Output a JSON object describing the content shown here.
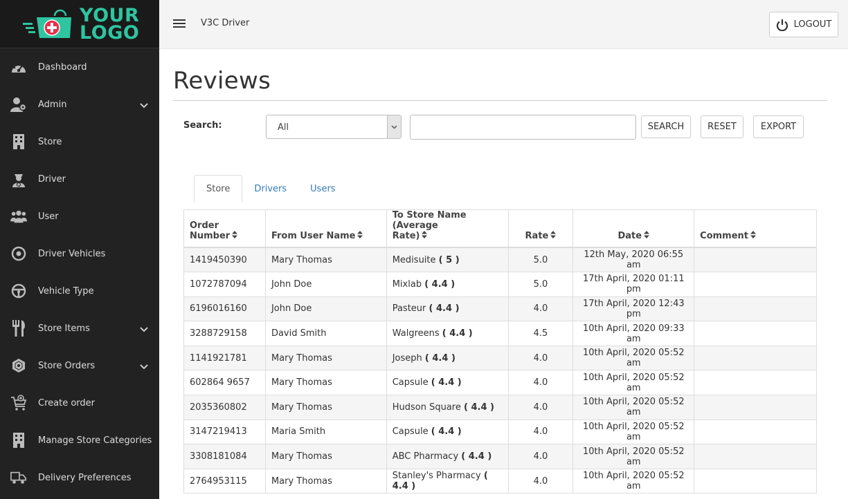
{
  "logo": {
    "line1": "YOUR",
    "line2": "LOGO"
  },
  "sidebar": {
    "items": [
      {
        "label": "Dashboard",
        "icon": "dashboard-icon"
      },
      {
        "label": "Admin",
        "icon": "admin-icon",
        "expandable": true
      },
      {
        "label": "Store",
        "icon": "building-icon"
      },
      {
        "label": "Driver",
        "icon": "driver-icon"
      },
      {
        "label": "User",
        "icon": "users-icon"
      },
      {
        "label": "Driver Vehicles",
        "icon": "target-icon"
      },
      {
        "label": "Vehicle Type",
        "icon": "steering-wheel-icon"
      },
      {
        "label": "Store Items",
        "icon": "utensils-icon",
        "expandable": true
      },
      {
        "label": "Store Orders",
        "icon": "orders-icon",
        "expandable": true
      },
      {
        "label": "Create order",
        "icon": "cart-plus-icon"
      },
      {
        "label": "Manage Store Categories",
        "icon": "building-icon"
      },
      {
        "label": "Delivery Preferences",
        "icon": "truck-icon"
      }
    ]
  },
  "header": {
    "app_title": "V3C Driver",
    "logout_label": "LOGOUT"
  },
  "page": {
    "title": "Reviews"
  },
  "search": {
    "label": "Search:",
    "select_value": "All",
    "input_value": "",
    "search_label": "SEARCH",
    "reset_label": "RESET",
    "export_label": "EXPORT"
  },
  "tabs": [
    {
      "label": "Store",
      "active": true
    },
    {
      "label": "Drivers",
      "active": false
    },
    {
      "label": "Users",
      "active": false
    }
  ],
  "table": {
    "headers": {
      "order_number": "Order Number",
      "from_user": "From User Name",
      "to_store_line1": "To Store Name (Average",
      "to_store_line2": "Rate)",
      "rate": "Rate",
      "date": "Date",
      "comment": "Comment"
    },
    "rows": [
      {
        "order": "1419450390",
        "user": "Mary Thomas",
        "store": "Medisuite",
        "avg": "( 5 )",
        "rate": "5.0",
        "date": "12th May, 2020 06:55 am",
        "comment": ""
      },
      {
        "order": "1072787094",
        "user": "John Doe",
        "store": "Mixlab",
        "avg": "( 4.4 )",
        "rate": "5.0",
        "date": "17th April, 2020 01:11 pm",
        "comment": ""
      },
      {
        "order": "6196016160",
        "user": "John Doe",
        "store": "Pasteur",
        "avg": "( 4.4 )",
        "rate": "4.0",
        "date": "17th April, 2020 12:43 pm",
        "comment": ""
      },
      {
        "order": "3288729158",
        "user": "David Smith",
        "store": "Walgreens",
        "avg": "( 4.4 )",
        "rate": "4.5",
        "date": "10th April, 2020 09:33 am",
        "comment": ""
      },
      {
        "order": "1141921781",
        "user": "Mary Thomas",
        "store": "Joseph",
        "avg": "( 4.4 )",
        "rate": "4.0",
        "date": "10th April, 2020 05:52 am",
        "comment": ""
      },
      {
        "order": "602864 9657",
        "user": "Mary Thomas",
        "store": "Capsule",
        "avg": "( 4.4 )",
        "rate": "4.0",
        "date": "10th April, 2020 05:52 am",
        "comment": ""
      },
      {
        "order": "2035360802",
        "user": "Mary Thomas",
        "store": "Hudson Square",
        "avg": "( 4.4 )",
        "rate": "4.0",
        "date": "10th April, 2020 05:52 am",
        "comment": ""
      },
      {
        "order": "3147219413",
        "user": "Maria Smith",
        "store": "Capsule",
        "avg": "( 4.4 )",
        "rate": "4.0",
        "date": "10th April, 2020 05:52 am",
        "comment": ""
      },
      {
        "order": "3308181084",
        "user": "Mary Thomas",
        "store": "ABC Pharmacy",
        "avg": "( 4.4 )",
        "rate": "4.0",
        "date": "10th April, 2020 05:52 am",
        "comment": ""
      },
      {
        "order": "2764953115",
        "user": "Mary Thomas",
        "store": "Stanley's Pharmacy",
        "avg": "( 4.4 )",
        "rate": "4.0",
        "date": "10th April, 2020 05:52 am",
        "comment": ""
      }
    ]
  },
  "colors": {
    "sidebar_bg": "#222222",
    "brand_teal": "#2ec5a0",
    "brand_red": "#e5304a",
    "link_blue": "#337ab7"
  }
}
